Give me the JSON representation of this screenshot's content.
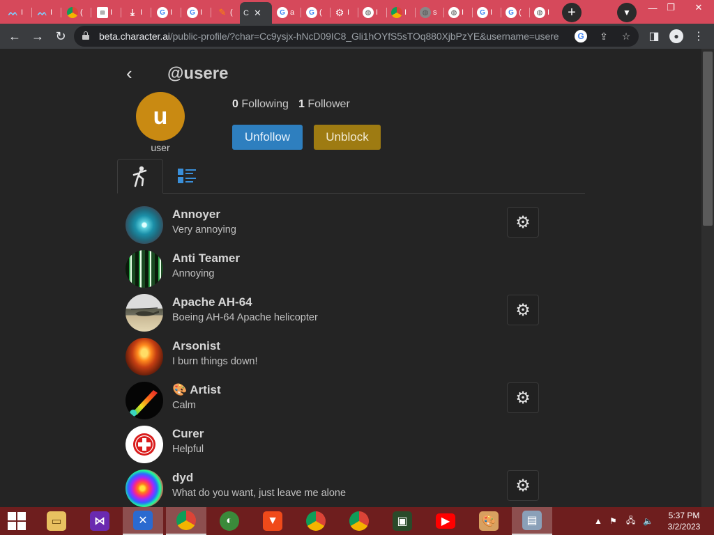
{
  "browser": {
    "tabs": [
      {
        "icon": "wave-icon",
        "text": "I"
      },
      {
        "icon": "wave-icon",
        "text": "I"
      },
      {
        "icon": "chrome-icon",
        "text": "("
      },
      {
        "icon": "book-icon",
        "text": "I"
      },
      {
        "icon": "download-icon",
        "text": "I"
      },
      {
        "icon": "google-icon",
        "text": "I"
      },
      {
        "icon": "google-icon",
        "text": "I"
      },
      {
        "icon": "pencil-icon",
        "text": "("
      },
      {
        "icon": "active-tab",
        "text": "C"
      },
      {
        "icon": "google-icon",
        "text": "a"
      },
      {
        "icon": "google-icon",
        "text": "("
      },
      {
        "icon": "gear-icon",
        "text": "I"
      },
      {
        "icon": "globe-icon",
        "text": "I"
      },
      {
        "icon": "chrome-icon",
        "text": "I"
      },
      {
        "icon": "globe-icon",
        "text": "s"
      },
      {
        "icon": "globe-icon",
        "text": "I"
      },
      {
        "icon": "google-icon",
        "text": "I"
      },
      {
        "icon": "google-icon",
        "text": "("
      },
      {
        "icon": "globe-icon",
        "text": "I"
      }
    ],
    "url_host": "beta.character.ai",
    "url_path": "/public-profile/?char=Cc9ysjx-hNcD09IC8_Gli1hOYfS5sTOq880XjbPzYE&username=usere",
    "google_badge": "G"
  },
  "profile": {
    "handle": "@usere",
    "avatar_letter": "u",
    "display_name": "user",
    "following_count": "0",
    "following_label": "Following",
    "followers_count": "1",
    "followers_label": "Follower",
    "unfollow_label": "Unfollow",
    "unblock_label": "Unblock"
  },
  "characters": [
    {
      "name": "Annoyer",
      "desc": "Very annoying",
      "has_settings": true
    },
    {
      "name": "Anti Teamer",
      "desc": "Annoying",
      "has_settings": false
    },
    {
      "name": "Apache AH-64",
      "desc": "Boeing AH-64 Apache helicopter",
      "has_settings": true
    },
    {
      "name": "Arsonist",
      "desc": "I burn things down!",
      "has_settings": false
    },
    {
      "name": "🎨 Artist",
      "desc": "Calm",
      "has_settings": true
    },
    {
      "name": "Curer",
      "desc": "Helpful",
      "has_settings": false
    },
    {
      "name": "dyd",
      "desc": "What do you want, just leave me alone",
      "has_settings": true
    }
  ],
  "taskbar": {
    "time": "5:37 PM",
    "date": "3/2/2023"
  },
  "colors": {
    "tabstrip": "#d6495b",
    "unfollow": "#2e7fbf",
    "unblock": "#9e7b12",
    "avatar": "#c98a12",
    "taskbar": "#6e1e1e"
  }
}
